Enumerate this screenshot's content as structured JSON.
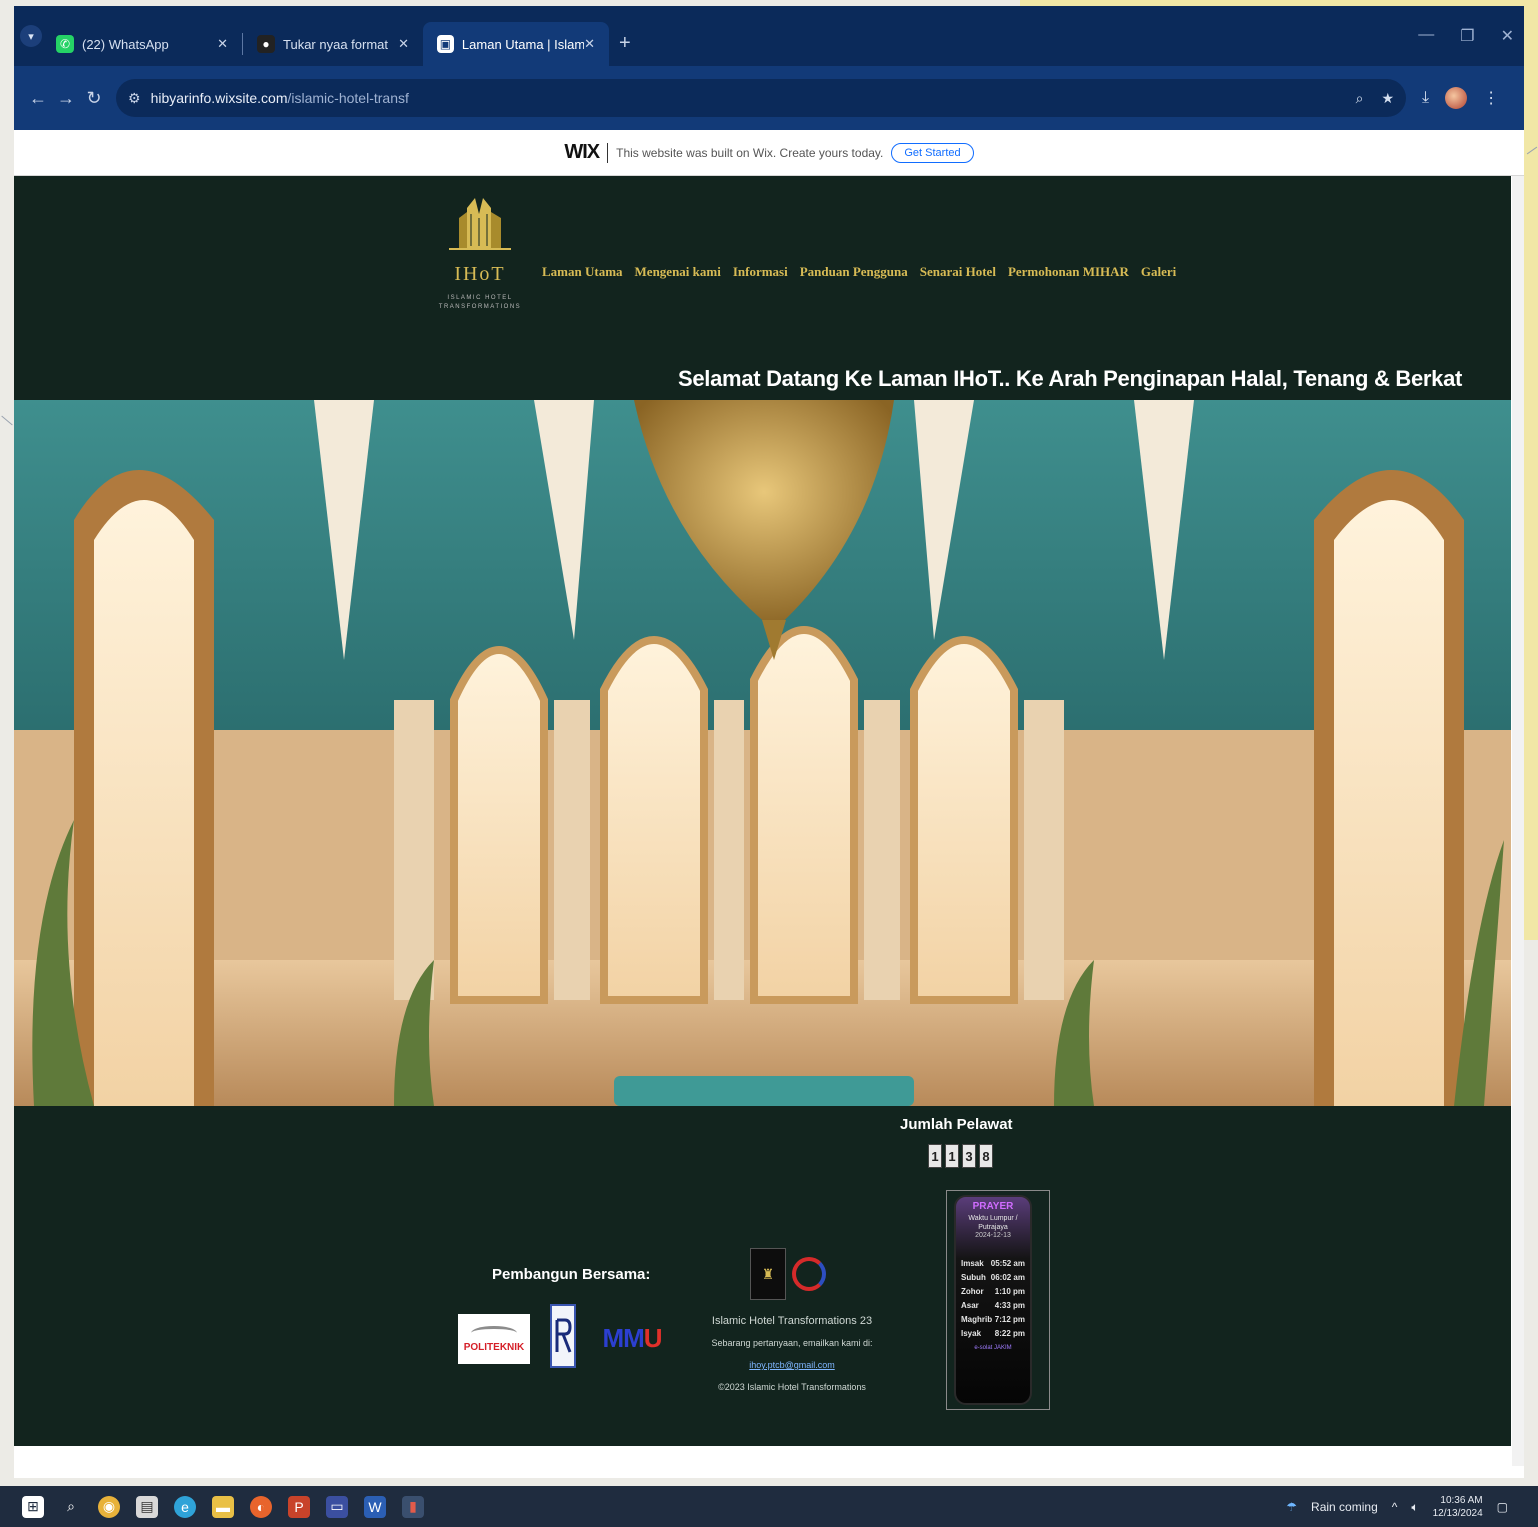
{
  "browser": {
    "tabs": [
      {
        "label": "(22) WhatsApp",
        "icon": "whatsapp-icon",
        "color": "#25d366",
        "active": false
      },
      {
        "label": "Tukar nyaa format",
        "icon": "app-icon",
        "color": "#222222",
        "active": false
      },
      {
        "label": "Laman Utama | Islamic Hotel Tr",
        "icon": "wix-icon",
        "color": "#ffffff",
        "active": true
      }
    ],
    "new_tab": "+",
    "url_domain": "hibyarinfo.wixsite.com",
    "url_path": "/islamic-hotel-transf"
  },
  "wix_banner": {
    "logo": "WIX",
    "text": "This website was built on Wix. Create yours today.",
    "button": "Get Started"
  },
  "site": {
    "logo_name": "IHoT",
    "logo_sub_1": "ISLAMIC HOTEL",
    "logo_sub_2": "TRANSFORMATIONS",
    "nav": [
      "Laman Utama",
      "Mengenai kami",
      "Informasi",
      "Panduan Pengguna",
      "Senarai Hotel",
      "Permohonan MIHAR",
      "Galeri"
    ],
    "welcome": "Selamat Datang Ke Laman IHoT.. Ke Arah Penginapan Halal, Tenang & Berkat",
    "visitor_title": "Jumlah Pelawat",
    "visitor_digits": [
      "1",
      "1",
      "3",
      "8"
    ],
    "developers_label": "Pembangun Bersama:",
    "partners": {
      "poli": "POLITEKNIK",
      "mmu_a": "MM",
      "mmu_b": "U"
    },
    "company_name": "Islamic Hotel Transformations 23",
    "company_contact_prefix": "Sebarang pertanyaan, emailkan kami di:",
    "company_email": "ihoy.ptcb@gmail.com",
    "copyright": "©2023 Islamic Hotel Transformations",
    "prayer": {
      "title": "PRAYER",
      "subtitle": "Waktu Lumpur / Putrajaya",
      "date": "2024-12-13",
      "rows": [
        {
          "name": "Imsak",
          "time": "05:52 am"
        },
        {
          "name": "Subuh",
          "time": "06:02 am"
        },
        {
          "name": "Zohor",
          "time": "1:10 pm"
        },
        {
          "name": "Asar",
          "time": "4:33 pm"
        },
        {
          "name": "Maghrib",
          "time": "7:12 pm"
        },
        {
          "name": "Isyak",
          "time": "8:22 pm"
        }
      ],
      "footer": "e-solat JAKIM"
    }
  },
  "taskbar": {
    "weather": "Rain coming",
    "time": "10:36 AM",
    "date": "12/13/2024"
  }
}
